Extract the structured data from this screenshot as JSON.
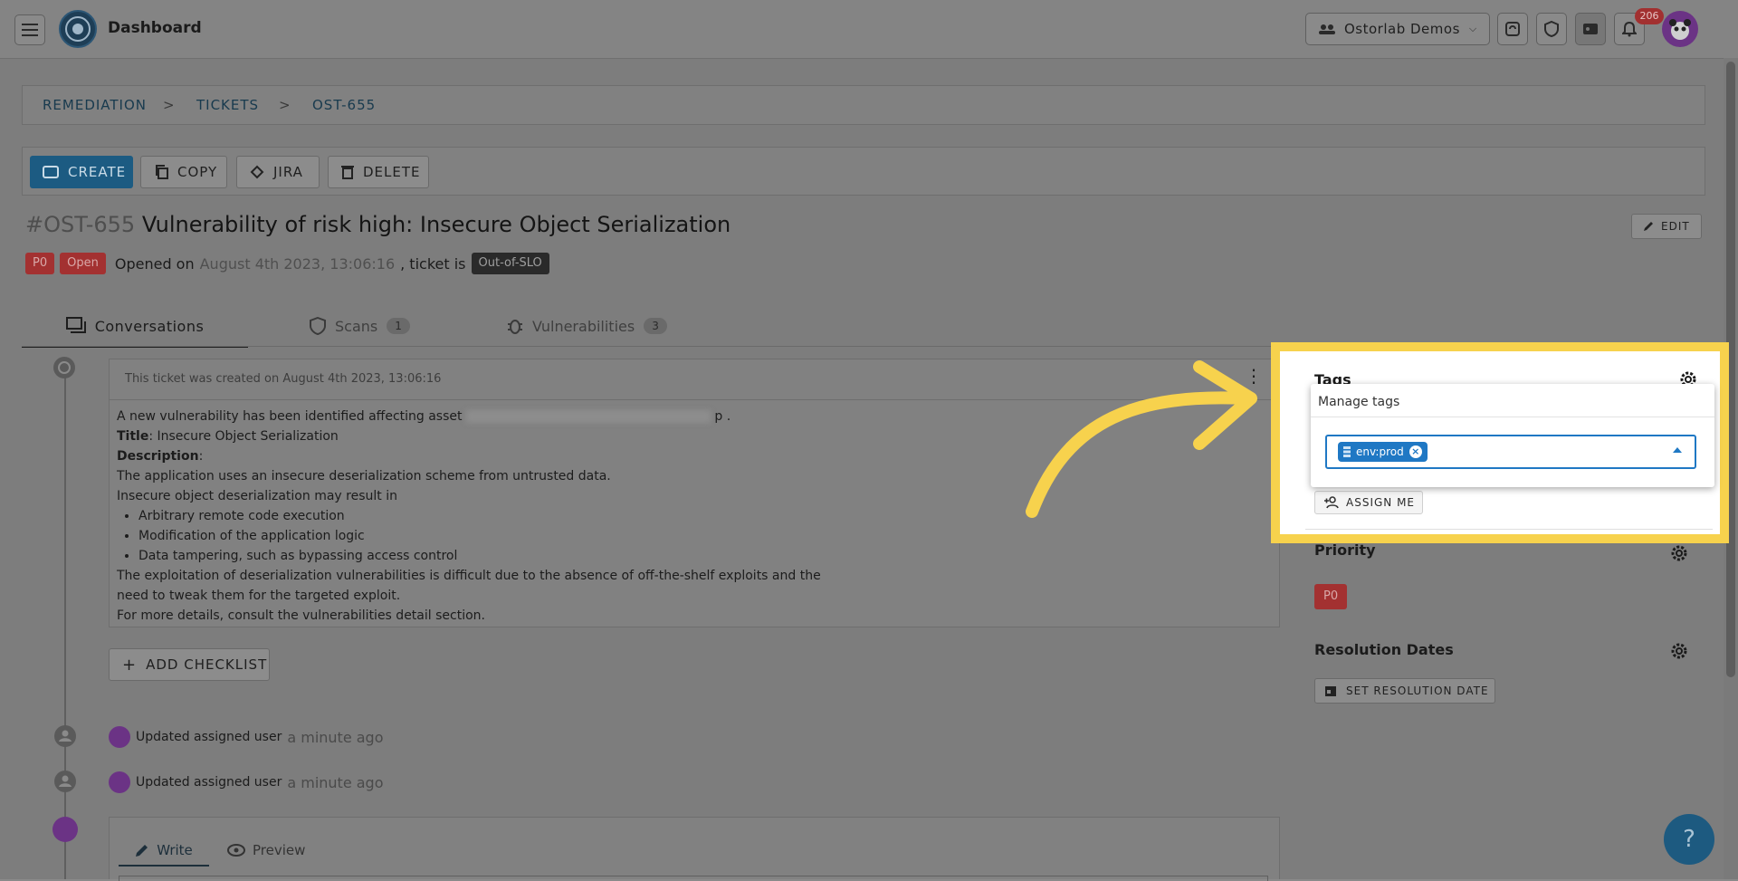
{
  "topbar": {
    "title": "Dashboard",
    "org_selector": "Ostorlab Demos",
    "notification_count": "206",
    "icons": [
      "menu-icon",
      "ostorlab-logo",
      "sync-icon",
      "shield-icon",
      "badge-icon",
      "bell-icon",
      "avatar"
    ]
  },
  "breadcrumb": {
    "items": [
      "REMEDIATION",
      "TICKETS",
      "OST-655"
    ],
    "separator": ">"
  },
  "toolbar": {
    "create": "CREATE",
    "copy": "COPY",
    "jira": "JIRA",
    "delete": "DELETE"
  },
  "ticket": {
    "id": "#OST-655",
    "title": "Vulnerability of risk high: Insecure Object Serialization",
    "priority_chip": "P0",
    "status_chip": "Open",
    "opened_label": "Opened on",
    "opened_date": "August 4th 2023, 13:06:16",
    "ticket_is": ", ticket is",
    "slo_chip": "Out-of-SLO",
    "edit_button": "EDIT"
  },
  "tabs": [
    {
      "label": "Conversations",
      "count": ""
    },
    {
      "label": "Scans",
      "count": "1"
    },
    {
      "label": "Vulnerabilities",
      "count": "3"
    }
  ],
  "conversation": {
    "created_note": "This ticket was created on August 4th 2023, 13:06:16",
    "intro": "A new vulnerability has been identified affecting asset",
    "intro_end": "p .",
    "title_label": "Title",
    "title_value": ": Insecure Object Serialization",
    "description_label": "Description",
    "description_colon": ":",
    "line1": "The application uses an insecure deserialization scheme from untrusted data.",
    "line2": "Insecure object deserialization may result in",
    "bullets": [
      "Arbitrary remote code execution",
      "Modification of the application logic",
      "Data tampering, such as bypassing access control"
    ],
    "line3": "The exploitation of deserialization vulnerabilities is difficult due to the absence of off-the-shelf exploits and the",
    "line4": "need to tweak them for the targeted exploit.",
    "line5": "For more details, consult the vulnerabilities detail section.",
    "add_checklist": "ADD CHECKLIST",
    "events": [
      {
        "text": "Updated assigned user",
        "time": "a minute ago"
      },
      {
        "text": "Updated assigned user",
        "time": "a minute ago"
      }
    ],
    "editor_tabs": {
      "write": "Write",
      "preview": "Preview"
    }
  },
  "sidebar": {
    "tags_heading": "Tags",
    "manage_tags": "Manage tags",
    "selected_tag": "env:prod",
    "assign_me": "ASSIGN ME",
    "priority_heading": "Priority",
    "priority_value": "P0",
    "resolution_heading": "Resolution Dates",
    "set_resolution": "SET RESOLUTION DATE"
  },
  "help_button": "?",
  "colors": {
    "highlight": "#f7d24d",
    "primary": "#1c74a8",
    "danger": "#c93b3b",
    "tag_chip": "#1f78c4",
    "purple_avatar": "#8b3fb0"
  }
}
